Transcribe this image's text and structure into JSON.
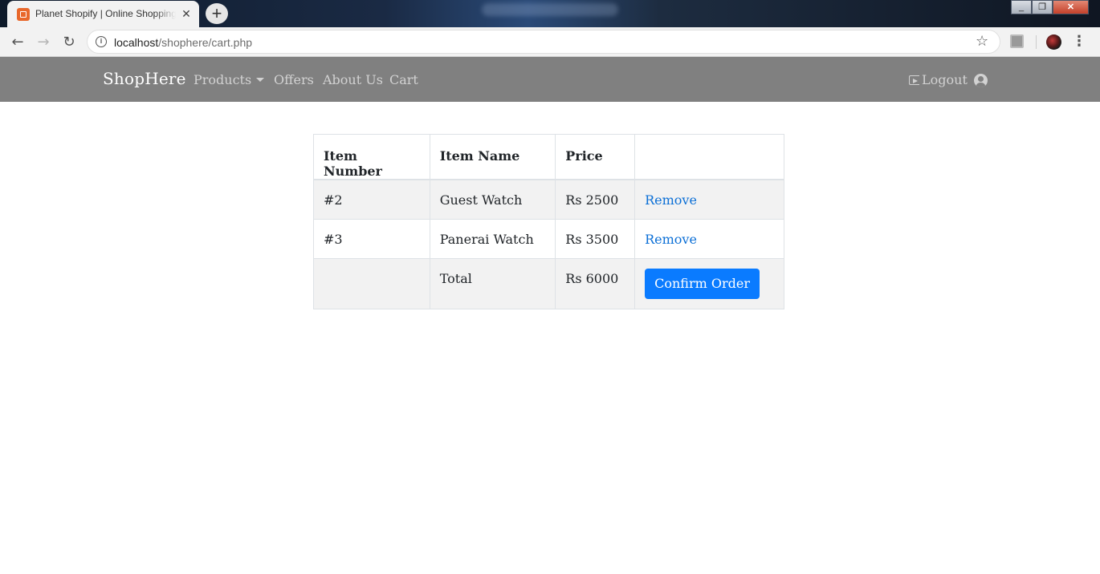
{
  "browser": {
    "tab_title": "Planet Shopify | Online Shopping",
    "new_tab_symbol": "+",
    "url_host": "localhost",
    "url_path": "/shophere/cart.php",
    "window_controls": [
      "_",
      "❐",
      "✕"
    ]
  },
  "navbar": {
    "brand": "ShopHere",
    "links": [
      "Products",
      "Offers",
      "About Us",
      "Cart"
    ],
    "logout": "Logout",
    "bg_color": "#808080"
  },
  "cart": {
    "headers": [
      "Item Number",
      "Item Name",
      "Price",
      ""
    ],
    "rows": [
      {
        "number": "#2",
        "name": "Guest Watch",
        "price": "Rs 2500",
        "action": "Remove"
      },
      {
        "number": "#3",
        "name": "Panerai Watch",
        "price": "Rs 3500",
        "action": "Remove"
      }
    ],
    "total_label": "Total",
    "total_value": "Rs 6000",
    "confirm_label": "Confirm Order",
    "accent_color": "#0a7bff"
  }
}
